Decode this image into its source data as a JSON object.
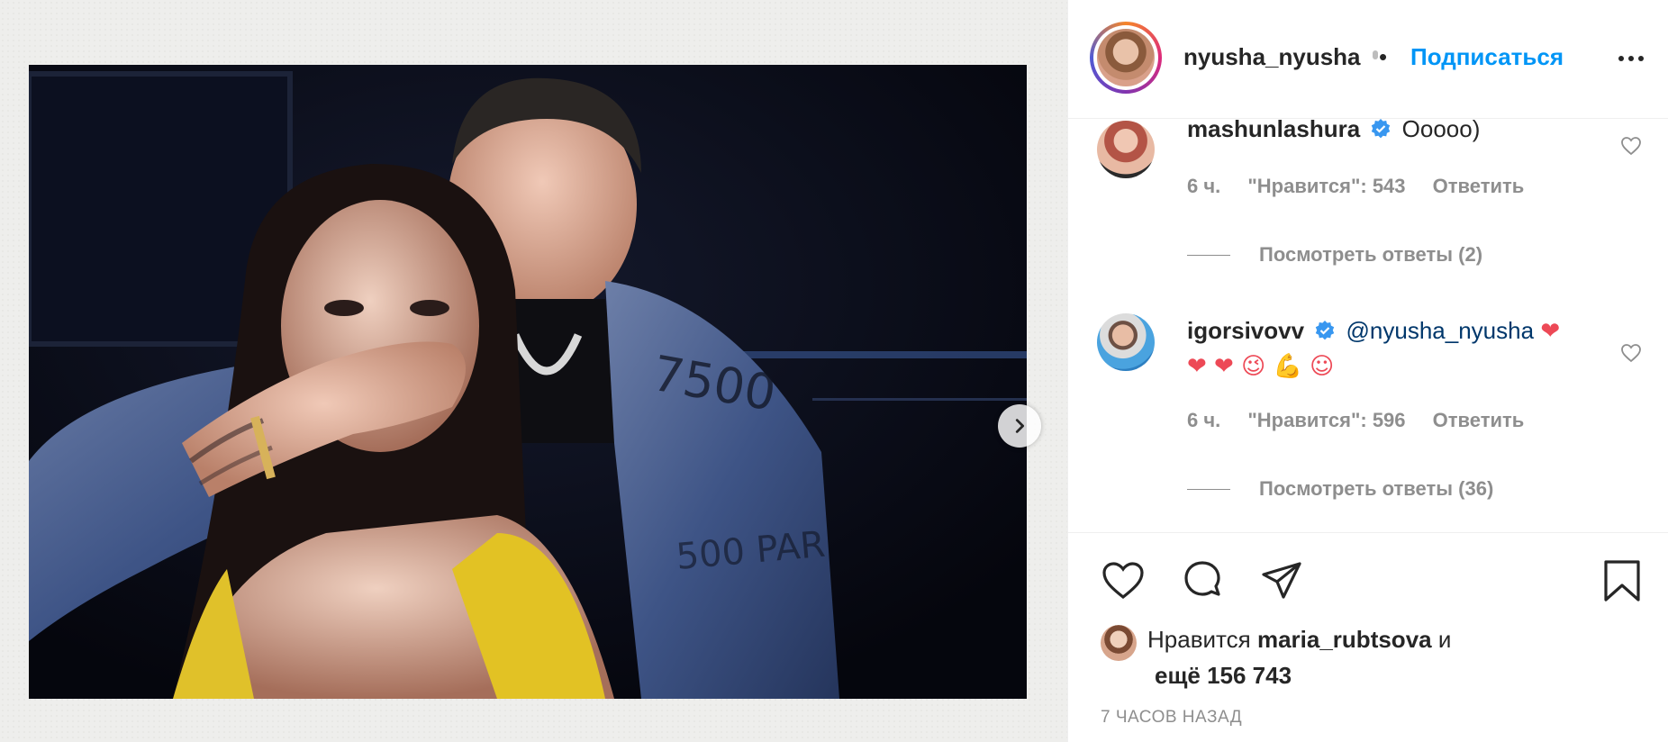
{
  "post": {
    "username": "nyusha_nyusha",
    "separator": "•",
    "follow_label": "Подписаться",
    "more_icon": "more-horizontal-icon"
  },
  "comments": [
    {
      "username": "mashunlashura",
      "verified": true,
      "text": "Ооооо)",
      "time": "6 ч.",
      "likes": "\"Нравится\": 543",
      "reply_label": "Ответить",
      "view_replies": "Посмотреть ответы (2)"
    },
    {
      "username": "igorsivovv",
      "verified": true,
      "mention": "@nyusha_nyusha",
      "emojis_line1": "❤",
      "emojis_line2": "❤ ❤  😉 💪 ☺",
      "time": "6 ч.",
      "likes": "\"Нравится\": 596",
      "reply_label": "Ответить",
      "view_replies": "Посмотреть ответы (36)"
    }
  ],
  "likes": {
    "prefix": "Нравится",
    "user": "maria_rubtsova",
    "conj": "и",
    "more": "ещё 156 743"
  },
  "time_ago": "7 ЧАСОВ НАЗАД",
  "colors": {
    "accent": "#0095f6",
    "text": "#262626",
    "muted": "#8e8e8e",
    "verified": "#3897f0"
  }
}
